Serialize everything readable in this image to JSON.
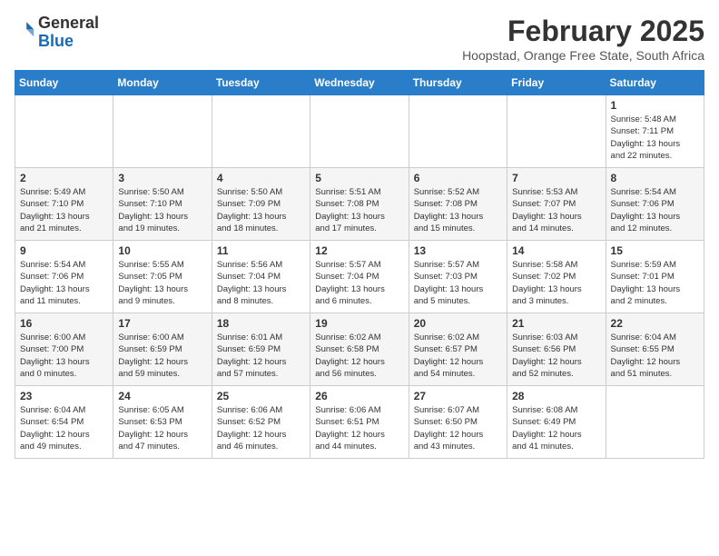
{
  "logo": {
    "general": "General",
    "blue": "Blue"
  },
  "header": {
    "month": "February 2025",
    "location": "Hoopstad, Orange Free State, South Africa"
  },
  "days_of_week": [
    "Sunday",
    "Monday",
    "Tuesday",
    "Wednesday",
    "Thursday",
    "Friday",
    "Saturday"
  ],
  "weeks": [
    [
      {
        "day": "",
        "info": ""
      },
      {
        "day": "",
        "info": ""
      },
      {
        "day": "",
        "info": ""
      },
      {
        "day": "",
        "info": ""
      },
      {
        "day": "",
        "info": ""
      },
      {
        "day": "",
        "info": ""
      },
      {
        "day": "1",
        "info": "Sunrise: 5:48 AM\nSunset: 7:11 PM\nDaylight: 13 hours\nand 22 minutes."
      }
    ],
    [
      {
        "day": "2",
        "info": "Sunrise: 5:49 AM\nSunset: 7:10 PM\nDaylight: 13 hours\nand 21 minutes."
      },
      {
        "day": "3",
        "info": "Sunrise: 5:50 AM\nSunset: 7:10 PM\nDaylight: 13 hours\nand 19 minutes."
      },
      {
        "day": "4",
        "info": "Sunrise: 5:50 AM\nSunset: 7:09 PM\nDaylight: 13 hours\nand 18 minutes."
      },
      {
        "day": "5",
        "info": "Sunrise: 5:51 AM\nSunset: 7:08 PM\nDaylight: 13 hours\nand 17 minutes."
      },
      {
        "day": "6",
        "info": "Sunrise: 5:52 AM\nSunset: 7:08 PM\nDaylight: 13 hours\nand 15 minutes."
      },
      {
        "day": "7",
        "info": "Sunrise: 5:53 AM\nSunset: 7:07 PM\nDaylight: 13 hours\nand 14 minutes."
      },
      {
        "day": "8",
        "info": "Sunrise: 5:54 AM\nSunset: 7:06 PM\nDaylight: 13 hours\nand 12 minutes."
      }
    ],
    [
      {
        "day": "9",
        "info": "Sunrise: 5:54 AM\nSunset: 7:06 PM\nDaylight: 13 hours\nand 11 minutes."
      },
      {
        "day": "10",
        "info": "Sunrise: 5:55 AM\nSunset: 7:05 PM\nDaylight: 13 hours\nand 9 minutes."
      },
      {
        "day": "11",
        "info": "Sunrise: 5:56 AM\nSunset: 7:04 PM\nDaylight: 13 hours\nand 8 minutes."
      },
      {
        "day": "12",
        "info": "Sunrise: 5:57 AM\nSunset: 7:04 PM\nDaylight: 13 hours\nand 6 minutes."
      },
      {
        "day": "13",
        "info": "Sunrise: 5:57 AM\nSunset: 7:03 PM\nDaylight: 13 hours\nand 5 minutes."
      },
      {
        "day": "14",
        "info": "Sunrise: 5:58 AM\nSunset: 7:02 PM\nDaylight: 13 hours\nand 3 minutes."
      },
      {
        "day": "15",
        "info": "Sunrise: 5:59 AM\nSunset: 7:01 PM\nDaylight: 13 hours\nand 2 minutes."
      }
    ],
    [
      {
        "day": "16",
        "info": "Sunrise: 6:00 AM\nSunset: 7:00 PM\nDaylight: 13 hours\nand 0 minutes."
      },
      {
        "day": "17",
        "info": "Sunrise: 6:00 AM\nSunset: 6:59 PM\nDaylight: 12 hours\nand 59 minutes."
      },
      {
        "day": "18",
        "info": "Sunrise: 6:01 AM\nSunset: 6:59 PM\nDaylight: 12 hours\nand 57 minutes."
      },
      {
        "day": "19",
        "info": "Sunrise: 6:02 AM\nSunset: 6:58 PM\nDaylight: 12 hours\nand 56 minutes."
      },
      {
        "day": "20",
        "info": "Sunrise: 6:02 AM\nSunset: 6:57 PM\nDaylight: 12 hours\nand 54 minutes."
      },
      {
        "day": "21",
        "info": "Sunrise: 6:03 AM\nSunset: 6:56 PM\nDaylight: 12 hours\nand 52 minutes."
      },
      {
        "day": "22",
        "info": "Sunrise: 6:04 AM\nSunset: 6:55 PM\nDaylight: 12 hours\nand 51 minutes."
      }
    ],
    [
      {
        "day": "23",
        "info": "Sunrise: 6:04 AM\nSunset: 6:54 PM\nDaylight: 12 hours\nand 49 minutes."
      },
      {
        "day": "24",
        "info": "Sunrise: 6:05 AM\nSunset: 6:53 PM\nDaylight: 12 hours\nand 47 minutes."
      },
      {
        "day": "25",
        "info": "Sunrise: 6:06 AM\nSunset: 6:52 PM\nDaylight: 12 hours\nand 46 minutes."
      },
      {
        "day": "26",
        "info": "Sunrise: 6:06 AM\nSunset: 6:51 PM\nDaylight: 12 hours\nand 44 minutes."
      },
      {
        "day": "27",
        "info": "Sunrise: 6:07 AM\nSunset: 6:50 PM\nDaylight: 12 hours\nand 43 minutes."
      },
      {
        "day": "28",
        "info": "Sunrise: 6:08 AM\nSunset: 6:49 PM\nDaylight: 12 hours\nand 41 minutes."
      },
      {
        "day": "",
        "info": ""
      }
    ]
  ]
}
